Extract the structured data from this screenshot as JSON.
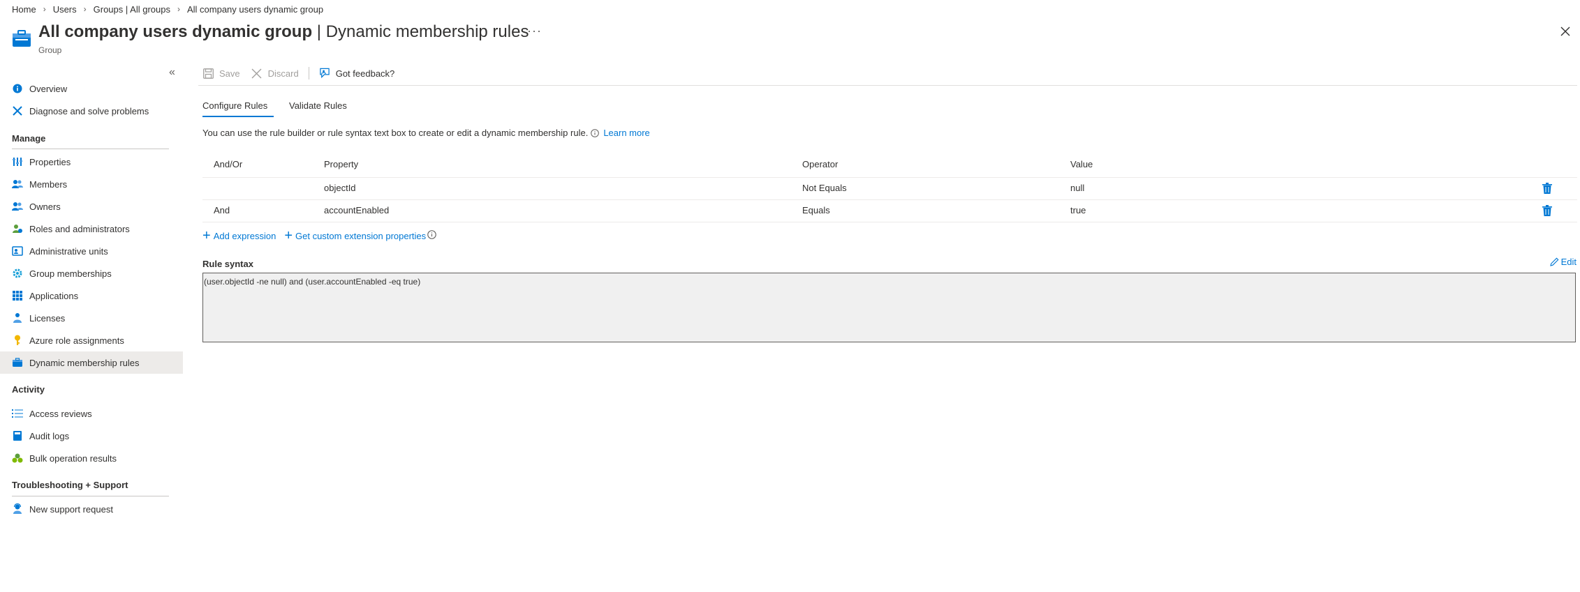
{
  "breadcrumb": [
    "Home",
    "Users",
    "Groups | All groups",
    "All company users dynamic group"
  ],
  "header": {
    "title_main": "All company users dynamic group",
    "title_sep": " | ",
    "title_page": "Dynamic membership rules",
    "subtitle": "Group",
    "more": "···"
  },
  "sidebar": {
    "top_items": [
      {
        "label": "Overview",
        "icon": "info-icon"
      },
      {
        "label": "Diagnose and solve problems",
        "icon": "wrench-icon"
      }
    ],
    "sections": [
      {
        "title": "Manage",
        "items": [
          {
            "label": "Properties",
            "icon": "properties-icon"
          },
          {
            "label": "Members",
            "icon": "members-icon"
          },
          {
            "label": "Owners",
            "icon": "owners-icon"
          },
          {
            "label": "Roles and administrators",
            "icon": "roles-icon"
          },
          {
            "label": "Administrative units",
            "icon": "admin-units-icon"
          },
          {
            "label": "Group memberships",
            "icon": "gear-icon"
          },
          {
            "label": "Applications",
            "icon": "apps-grid-icon"
          },
          {
            "label": "Licenses",
            "icon": "license-icon"
          },
          {
            "label": "Azure role assignments",
            "icon": "key-icon"
          },
          {
            "label": "Dynamic membership rules",
            "icon": "dynamic-rules-icon",
            "active": true
          }
        ]
      },
      {
        "title": "Activity",
        "items": [
          {
            "label": "Access reviews",
            "icon": "list-icon"
          },
          {
            "label": "Audit logs",
            "icon": "book-icon"
          },
          {
            "label": "Bulk operation results",
            "icon": "bulk-icon"
          }
        ]
      },
      {
        "title": "Troubleshooting + Support",
        "items": [
          {
            "label": "New support request",
            "icon": "support-icon"
          }
        ]
      }
    ]
  },
  "toolbar": {
    "save": "Save",
    "discard": "Discard",
    "feedback": "Got feedback?"
  },
  "tabs": [
    "Configure Rules",
    "Validate Rules"
  ],
  "info": {
    "text": "You can use the rule builder or rule syntax text box to create or edit a dynamic membership rule.",
    "link": "Learn more"
  },
  "table": {
    "headers": [
      "And/Or",
      "Property",
      "Operator",
      "Value"
    ],
    "rows": [
      {
        "andor": "",
        "property": "objectId",
        "operator": "Not Equals",
        "value": "null"
      },
      {
        "andor": "And",
        "property": "accountEnabled",
        "operator": "Equals",
        "value": "true"
      }
    ]
  },
  "actions": {
    "add_expression": "Add expression",
    "custom_ext": "Get custom extension properties"
  },
  "rule": {
    "label": "Rule syntax",
    "edit": "Edit",
    "syntax": "(user.objectId -ne null) and (user.accountEnabled -eq true)"
  },
  "colors": {
    "accent": "#0078d4",
    "active_nav": "#edebe9",
    "rule_box_bg": "#f0f0f0"
  }
}
